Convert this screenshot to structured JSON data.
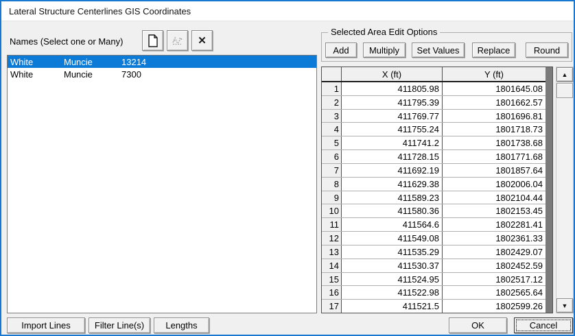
{
  "window": {
    "title": "Lateral Structure Centerlines GIS Coordinates"
  },
  "names_panel": {
    "label": "Names (Select one or Many)",
    "toolbar": [
      {
        "id": "new-line",
        "icon": "new-document-icon",
        "disabled": false
      },
      {
        "id": "rename-line",
        "icon": "rename-icon",
        "disabled": true
      },
      {
        "id": "delete-line",
        "icon": "delete-x-icon",
        "disabled": false
      }
    ],
    "items": [
      {
        "river": "White",
        "reach": "Muncie",
        "rs": "13214",
        "selected": true
      },
      {
        "river": "White",
        "reach": "Muncie",
        "rs": "7300",
        "selected": false
      }
    ]
  },
  "edit_options": {
    "title": "Selected Area Edit Options",
    "buttons": [
      "Add",
      "Multiply",
      "Set Values",
      "Replace",
      "Round"
    ]
  },
  "table": {
    "columns": [
      "",
      "X (ft)",
      "Y (ft)"
    ],
    "rows": [
      [
        "1",
        "411805.98",
        "1801645.08"
      ],
      [
        "2",
        "411795.39",
        "1801662.57"
      ],
      [
        "3",
        "411769.77",
        "1801696.81"
      ],
      [
        "4",
        "411755.24",
        "1801718.73"
      ],
      [
        "5",
        "411741.2",
        "1801738.68"
      ],
      [
        "6",
        "411728.15",
        "1801771.68"
      ],
      [
        "7",
        "411692.19",
        "1801857.64"
      ],
      [
        "8",
        "411629.38",
        "1802006.04"
      ],
      [
        "9",
        "411589.23",
        "1802104.44"
      ],
      [
        "10",
        "411580.36",
        "1802153.45"
      ],
      [
        "11",
        "411564.6",
        "1802281.41"
      ],
      [
        "12",
        "411549.08",
        "1802361.33"
      ],
      [
        "13",
        "411535.29",
        "1802429.07"
      ],
      [
        "14",
        "411530.37",
        "1802452.59"
      ],
      [
        "15",
        "411524.95",
        "1802517.12"
      ],
      [
        "16",
        "411522.98",
        "1802565.64"
      ],
      [
        "17",
        "411521.5",
        "1802599.26"
      ]
    ]
  },
  "footer": {
    "import_lines": "Import Lines",
    "filter_lines": "Filter Line(s)",
    "lengths": "Lengths",
    "ok": "OK",
    "cancel": "Cancel"
  },
  "colors": {
    "accent_border": "#1878d1",
    "selection": "#0b7bd7",
    "dialog_bg": "#f0f0f0",
    "grid_filler": "#7b7b7b"
  }
}
